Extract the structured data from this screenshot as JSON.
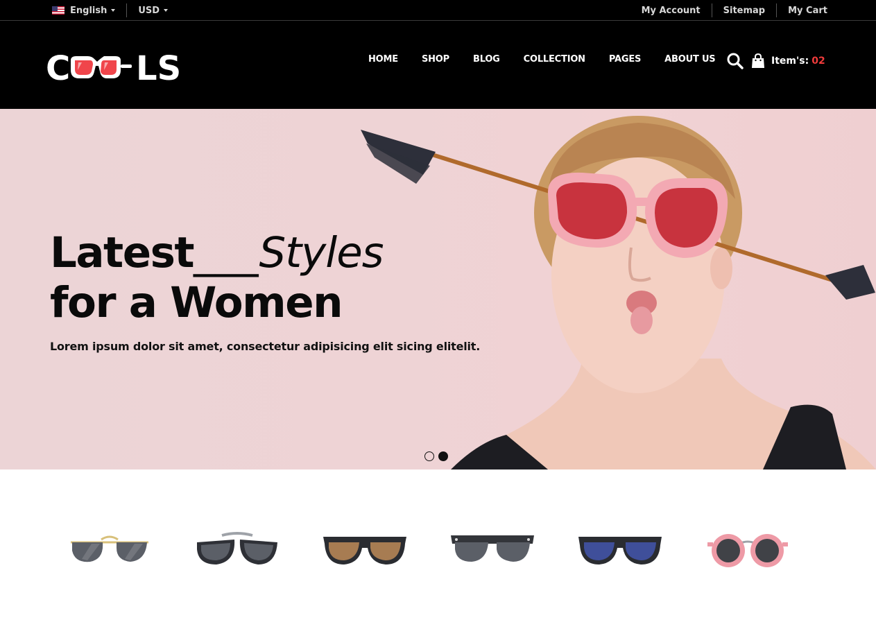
{
  "topbar": {
    "language": "English",
    "currency": "USD",
    "links": [
      "My Account",
      "Sitemap",
      "My Cart"
    ]
  },
  "header": {
    "logo_text": "COOLS",
    "nav": [
      "HOME",
      "SHOP",
      "BLOG",
      "COLLECTION",
      "PAGES",
      "ABOUT US"
    ],
    "cart_label": "Item's:",
    "cart_count": "02"
  },
  "hero": {
    "title_word1": "Latest",
    "title_separator": "___",
    "title_word2": "Styles",
    "title_line2": "for a Women",
    "description": "Lorem ipsum dolor sit amet, consectetur adipisicing elit sicing elitelit.",
    "slides": 2,
    "active_slide": 2
  },
  "icons": [
    "us-flag-icon",
    "chevron-down-icon",
    "search-icon",
    "shopping-bag-icon"
  ],
  "products": [
    {
      "name": "glasses-aviator-gold",
      "lens": "#5b5f67",
      "frame": "#d8c07a"
    },
    {
      "name": "glasses-round-black",
      "lens": "#5b5f67",
      "frame": "#2e3036"
    },
    {
      "name": "glasses-square-brown",
      "lens": "#a77c52",
      "frame": "#2a2c31"
    },
    {
      "name": "glasses-clubmaster-black",
      "lens": "#5b5f67",
      "frame": "#33353a"
    },
    {
      "name": "glasses-wayfarer-blue",
      "lens": "#3f4f9a",
      "frame": "#2a2c31"
    },
    {
      "name": "glasses-round-pink",
      "lens": "#404247",
      "frame": "#ee9aa6"
    }
  ],
  "colors": {
    "accent": "#f03b3b",
    "bar_bg": "#000000",
    "hero_bg": "#eed3d5"
  }
}
